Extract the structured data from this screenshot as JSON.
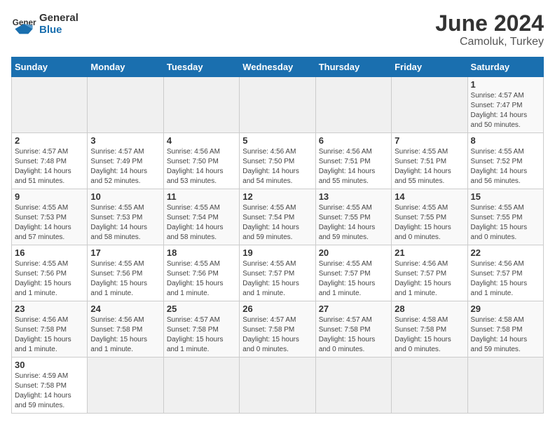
{
  "header": {
    "logo_general": "General",
    "logo_blue": "Blue",
    "month_year": "June 2024",
    "location": "Camoluk, Turkey"
  },
  "days_of_week": [
    "Sunday",
    "Monday",
    "Tuesday",
    "Wednesday",
    "Thursday",
    "Friday",
    "Saturday"
  ],
  "weeks": [
    [
      {
        "day": "",
        "info": ""
      },
      {
        "day": "",
        "info": ""
      },
      {
        "day": "",
        "info": ""
      },
      {
        "day": "",
        "info": ""
      },
      {
        "day": "",
        "info": ""
      },
      {
        "day": "",
        "info": ""
      },
      {
        "day": "1",
        "info": "Sunrise: 4:57 AM\nSunset: 7:47 PM\nDaylight: 14 hours\nand 50 minutes."
      }
    ],
    [
      {
        "day": "2",
        "info": "Sunrise: 4:57 AM\nSunset: 7:48 PM\nDaylight: 14 hours\nand 51 minutes."
      },
      {
        "day": "3",
        "info": "Sunrise: 4:57 AM\nSunset: 7:49 PM\nDaylight: 14 hours\nand 52 minutes."
      },
      {
        "day": "4",
        "info": "Sunrise: 4:56 AM\nSunset: 7:50 PM\nDaylight: 14 hours\nand 53 minutes."
      },
      {
        "day": "5",
        "info": "Sunrise: 4:56 AM\nSunset: 7:50 PM\nDaylight: 14 hours\nand 54 minutes."
      },
      {
        "day": "6",
        "info": "Sunrise: 4:56 AM\nSunset: 7:51 PM\nDaylight: 14 hours\nand 55 minutes."
      },
      {
        "day": "7",
        "info": "Sunrise: 4:55 AM\nSunset: 7:51 PM\nDaylight: 14 hours\nand 55 minutes."
      },
      {
        "day": "8",
        "info": "Sunrise: 4:55 AM\nSunset: 7:52 PM\nDaylight: 14 hours\nand 56 minutes."
      }
    ],
    [
      {
        "day": "9",
        "info": "Sunrise: 4:55 AM\nSunset: 7:53 PM\nDaylight: 14 hours\nand 57 minutes."
      },
      {
        "day": "10",
        "info": "Sunrise: 4:55 AM\nSunset: 7:53 PM\nDaylight: 14 hours\nand 58 minutes."
      },
      {
        "day": "11",
        "info": "Sunrise: 4:55 AM\nSunset: 7:54 PM\nDaylight: 14 hours\nand 58 minutes."
      },
      {
        "day": "12",
        "info": "Sunrise: 4:55 AM\nSunset: 7:54 PM\nDaylight: 14 hours\nand 59 minutes."
      },
      {
        "day": "13",
        "info": "Sunrise: 4:55 AM\nSunset: 7:55 PM\nDaylight: 14 hours\nand 59 minutes."
      },
      {
        "day": "14",
        "info": "Sunrise: 4:55 AM\nSunset: 7:55 PM\nDaylight: 15 hours\nand 0 minutes."
      },
      {
        "day": "15",
        "info": "Sunrise: 4:55 AM\nSunset: 7:55 PM\nDaylight: 15 hours\nand 0 minutes."
      }
    ],
    [
      {
        "day": "16",
        "info": "Sunrise: 4:55 AM\nSunset: 7:56 PM\nDaylight: 15 hours\nand 1 minute."
      },
      {
        "day": "17",
        "info": "Sunrise: 4:55 AM\nSunset: 7:56 PM\nDaylight: 15 hours\nand 1 minute."
      },
      {
        "day": "18",
        "info": "Sunrise: 4:55 AM\nSunset: 7:56 PM\nDaylight: 15 hours\nand 1 minute."
      },
      {
        "day": "19",
        "info": "Sunrise: 4:55 AM\nSunset: 7:57 PM\nDaylight: 15 hours\nand 1 minute."
      },
      {
        "day": "20",
        "info": "Sunrise: 4:55 AM\nSunset: 7:57 PM\nDaylight: 15 hours\nand 1 minute."
      },
      {
        "day": "21",
        "info": "Sunrise: 4:56 AM\nSunset: 7:57 PM\nDaylight: 15 hours\nand 1 minute."
      },
      {
        "day": "22",
        "info": "Sunrise: 4:56 AM\nSunset: 7:57 PM\nDaylight: 15 hours\nand 1 minute."
      }
    ],
    [
      {
        "day": "23",
        "info": "Sunrise: 4:56 AM\nSunset: 7:58 PM\nDaylight: 15 hours\nand 1 minute."
      },
      {
        "day": "24",
        "info": "Sunrise: 4:56 AM\nSunset: 7:58 PM\nDaylight: 15 hours\nand 1 minute."
      },
      {
        "day": "25",
        "info": "Sunrise: 4:57 AM\nSunset: 7:58 PM\nDaylight: 15 hours\nand 1 minute."
      },
      {
        "day": "26",
        "info": "Sunrise: 4:57 AM\nSunset: 7:58 PM\nDaylight: 15 hours\nand 0 minutes."
      },
      {
        "day": "27",
        "info": "Sunrise: 4:57 AM\nSunset: 7:58 PM\nDaylight: 15 hours\nand 0 minutes."
      },
      {
        "day": "28",
        "info": "Sunrise: 4:58 AM\nSunset: 7:58 PM\nDaylight: 15 hours\nand 0 minutes."
      },
      {
        "day": "29",
        "info": "Sunrise: 4:58 AM\nSunset: 7:58 PM\nDaylight: 14 hours\nand 59 minutes."
      }
    ],
    [
      {
        "day": "30",
        "info": "Sunrise: 4:59 AM\nSunset: 7:58 PM\nDaylight: 14 hours\nand 59 minutes."
      },
      {
        "day": "",
        "info": ""
      },
      {
        "day": "",
        "info": ""
      },
      {
        "day": "",
        "info": ""
      },
      {
        "day": "",
        "info": ""
      },
      {
        "day": "",
        "info": ""
      },
      {
        "day": "",
        "info": ""
      }
    ]
  ]
}
